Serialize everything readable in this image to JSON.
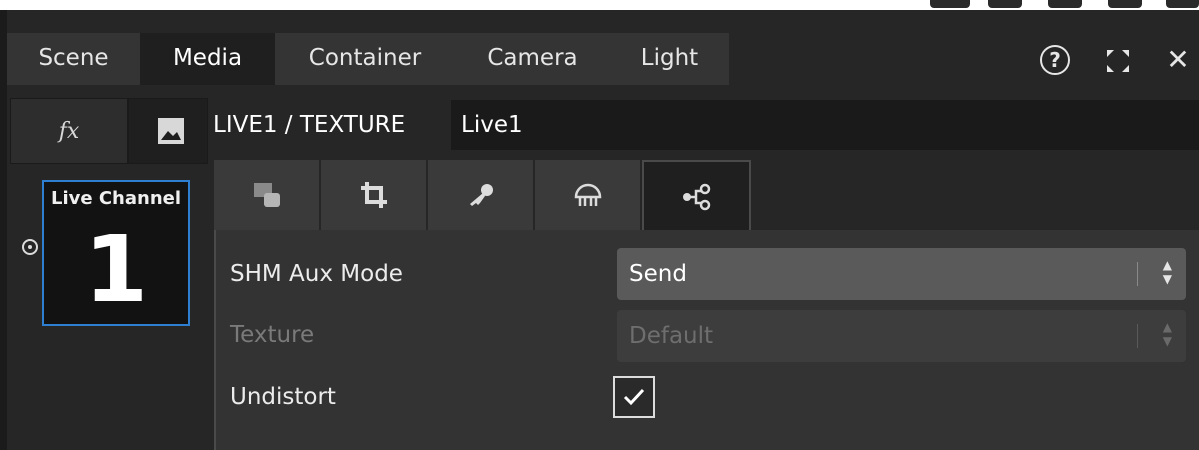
{
  "main_tabs": [
    {
      "label": "Scene"
    },
    {
      "label": "Media"
    },
    {
      "label": "Container"
    },
    {
      "label": "Camera"
    },
    {
      "label": "Light"
    }
  ],
  "window_controls": {
    "help_label": "?",
    "close_label": "✕"
  },
  "side_tabs": {
    "fx_label": "fx"
  },
  "header": {
    "path": "LIVE1 / TEXTURE",
    "name_value": "Live1"
  },
  "live_tile": {
    "label": "Live Channel",
    "number": "1"
  },
  "sub_tabs": [
    {
      "icon": "film-storage-icon"
    },
    {
      "icon": "crop-icon"
    },
    {
      "icon": "key-icon"
    },
    {
      "icon": "dome-icon"
    },
    {
      "icon": "share-icon"
    }
  ],
  "properties": {
    "shm_label": "SHM Aux Mode",
    "shm_value": "Send",
    "texture_label": "Texture",
    "texture_value": "Default",
    "undistort_label": "Undistort",
    "undistort_checked": true
  },
  "colors": {
    "accent": "#2e7fd1",
    "background": "#262626",
    "panel": "#333333"
  }
}
